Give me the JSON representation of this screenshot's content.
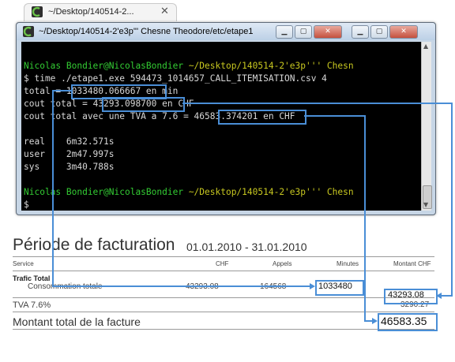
{
  "tab": {
    "title": "~/Desktop/140514-2...",
    "close": "✕"
  },
  "window": {
    "title": "~/Desktop/140514-2'e3p''' Chesne Theodore/etc/etape1"
  },
  "terminal": {
    "prompt_user": "Nicolas Bondier@NicolasBondier",
    "prompt_path": " ~/Desktop/140514-2'e3p''' Chesn",
    "command": "$ time ./etape1.exe 594473_1014657_CALL_ITEMISATION.csv 4",
    "total_label": "total = ",
    "total_value": "1033480.066667",
    "total_unit": " en min",
    "cout_label": "cout total = ",
    "cout_value": "43293.098700",
    "cout_unit": " en CHF",
    "tva_label": "cout total avec une TVA a 7.6 = ",
    "tva_value": "46583.374201",
    "tva_unit": " en CHF",
    "time_real": "real    6m32.571s",
    "time_user": "user    2m47.997s",
    "time_sys": "sys     3m40.788s",
    "prompt2_user": "Nicolas Bondier@NicolasBondier",
    "prompt2_path": " ~/Desktop/140514-2'e3p''' Chesn",
    "last_prompt": "$"
  },
  "invoice": {
    "title": "Période de facturation",
    "period": "01.01.2010 - 31.01.2010",
    "columns": [
      "Service",
      "CHF",
      "Appels",
      "Minutes",
      "Montant CHF"
    ],
    "section": "Trafic Total",
    "row_label": "Consommation totale",
    "row_chf": "43293.08",
    "row_appels": "164568",
    "row_minutes": "1033480",
    "row_montant": "43293.08",
    "tva_label": "TVA 7.6%",
    "tva_value": "3290.27",
    "total_label": "Montant total de la facture",
    "total_value": "46583.35"
  },
  "colors": {
    "highlight": "#4a8ed6",
    "prompt_green": "#33cc33",
    "prompt_yellow": "#c8c820"
  }
}
